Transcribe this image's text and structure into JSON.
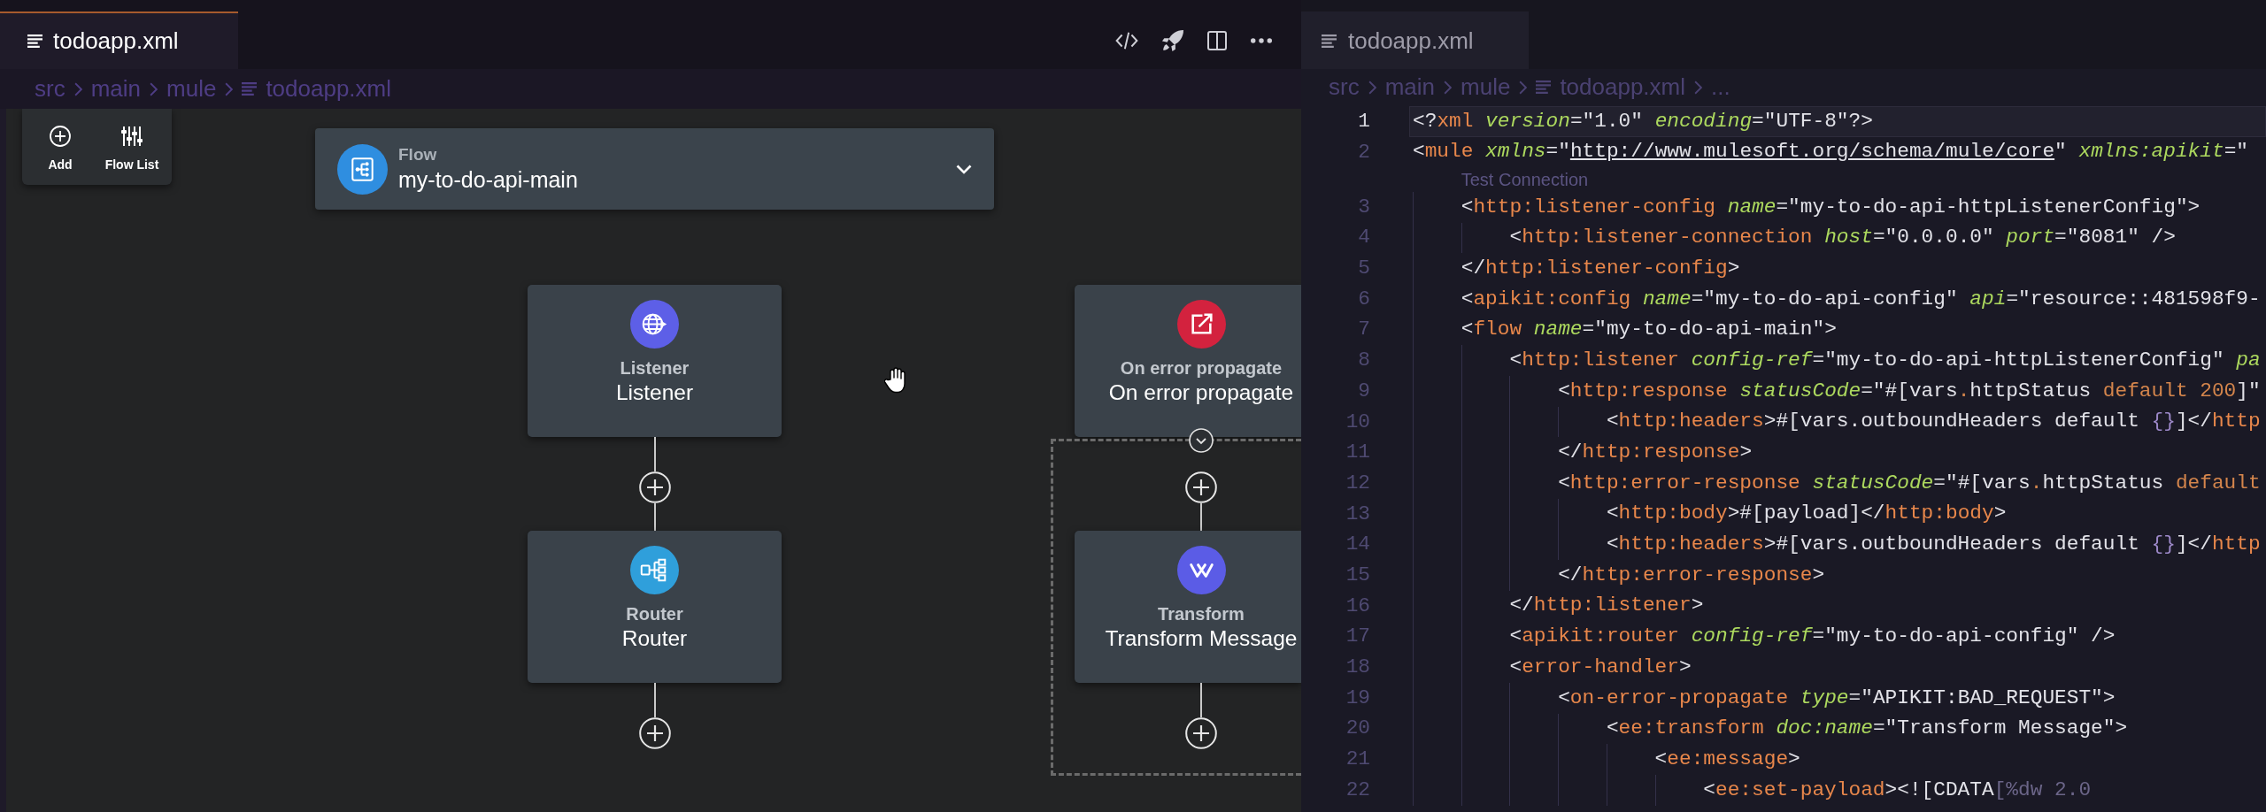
{
  "left_editor": {
    "tab": {
      "label": "todoapp.xml",
      "selected": true,
      "focused": true
    },
    "breadcrumbs": [
      {
        "label": "src",
        "kind": "folder"
      },
      {
        "label": "main",
        "kind": "folder"
      },
      {
        "label": "mule",
        "kind": "folder"
      },
      {
        "label": "todoapp.xml",
        "kind": "file"
      }
    ],
    "canvas": {
      "palette": [
        {
          "label": "Add",
          "kind": "add"
        },
        {
          "label": "Flow List",
          "kind": "flow-list"
        }
      ],
      "flow": {
        "type_label": "Flow",
        "name": "my-to-do-api-main"
      },
      "lanes": [
        {
          "kind": "flow",
          "components": [
            {
              "kind": "listener",
              "type_label": "Listener",
              "name": "Listener"
            },
            {
              "kind": "router",
              "type_label": "Router",
              "name": "Router"
            }
          ]
        },
        {
          "kind": "error-handler",
          "expanded": true,
          "handler": {
            "kind": "on-error",
            "type_label": "On error propagate",
            "name": "On error propagate"
          },
          "components": [
            {
              "kind": "transform",
              "type_label": "Transform",
              "name": "Transform Message"
            }
          ]
        }
      ]
    }
  },
  "right_editor": {
    "tab": {
      "label": "todoapp.xml",
      "selected": true,
      "focused": false
    },
    "breadcrumbs": [
      {
        "label": "src",
        "kind": "folder"
      },
      {
        "label": "main",
        "kind": "folder"
      },
      {
        "label": "mule",
        "kind": "folder"
      },
      {
        "label": "todoapp.xml",
        "kind": "file"
      },
      {
        "label": "...",
        "kind": "more"
      }
    ],
    "lines": [
      {
        "kind": "code",
        "number": "1",
        "current": true,
        "tokens": [
          {
            "kind": "plain",
            "text": "<?"
          },
          {
            "kind": "tag",
            "text": "xml "
          },
          {
            "kind": "attr",
            "text": "version"
          },
          {
            "kind": "plain",
            "text": "=\"1.0\" "
          },
          {
            "kind": "attr",
            "text": "encoding"
          },
          {
            "kind": "plain",
            "text": "=\"UTF-8\"?>"
          }
        ]
      },
      {
        "kind": "code",
        "number": "2",
        "current": false,
        "tokens": [
          {
            "kind": "plain",
            "text": "<"
          },
          {
            "kind": "tag",
            "text": "mule "
          },
          {
            "kind": "attr",
            "text": "xmlns"
          },
          {
            "kind": "plain",
            "text": "=\""
          },
          {
            "kind": "link",
            "text": "http://www.mulesoft.org/schema/mule/core"
          },
          {
            "kind": "plain",
            "text": "\" "
          },
          {
            "kind": "attr",
            "text": "xmlns:apikit"
          },
          {
            "kind": "plain",
            "text": "=\""
          }
        ]
      },
      {
        "kind": "codelens",
        "label": "Test Connection"
      },
      {
        "kind": "code",
        "number": "3",
        "current": false,
        "tokens": [
          {
            "kind": "plain",
            "text": "    <"
          },
          {
            "kind": "tag",
            "text": "http:listener-config "
          },
          {
            "kind": "attr",
            "text": "name"
          },
          {
            "kind": "plain",
            "text": "=\"my-to-do-api-httpListenerConfig\">"
          }
        ]
      },
      {
        "kind": "code",
        "number": "4",
        "current": false,
        "tokens": [
          {
            "kind": "plain",
            "text": "        <"
          },
          {
            "kind": "tag",
            "text": "http:listener-connection "
          },
          {
            "kind": "attr",
            "text": "host"
          },
          {
            "kind": "plain",
            "text": "=\"0.0.0.0\" "
          },
          {
            "kind": "attr",
            "text": "port"
          },
          {
            "kind": "plain",
            "text": "=\"8081\" />"
          }
        ]
      },
      {
        "kind": "code",
        "number": "5",
        "current": false,
        "tokens": [
          {
            "kind": "plain",
            "text": "    </"
          },
          {
            "kind": "tag",
            "text": "http:listener-config"
          },
          {
            "kind": "plain",
            "text": ">"
          }
        ]
      },
      {
        "kind": "code",
        "number": "6",
        "current": false,
        "tokens": [
          {
            "kind": "plain",
            "text": "    <"
          },
          {
            "kind": "tag",
            "text": "apikit:config "
          },
          {
            "kind": "attr",
            "text": "name"
          },
          {
            "kind": "plain",
            "text": "=\"my-to-do-api-config\" "
          },
          {
            "kind": "attr",
            "text": "api"
          },
          {
            "kind": "plain",
            "text": "=\"resource::481598f9-"
          }
        ]
      },
      {
        "kind": "code",
        "number": "7",
        "current": false,
        "tokens": [
          {
            "kind": "plain",
            "text": "    <"
          },
          {
            "kind": "tag",
            "text": "flow "
          },
          {
            "kind": "attr",
            "text": "name"
          },
          {
            "kind": "plain",
            "text": "=\"my-to-do-api-main\">"
          }
        ]
      },
      {
        "kind": "code",
        "number": "8",
        "current": false,
        "tokens": [
          {
            "kind": "plain",
            "text": "        <"
          },
          {
            "kind": "tag",
            "text": "http:listener "
          },
          {
            "kind": "attr",
            "text": "config-ref"
          },
          {
            "kind": "plain",
            "text": "=\"my-to-do-api-httpListenerConfig\" "
          },
          {
            "kind": "attr",
            "text": "pa"
          }
        ]
      },
      {
        "kind": "code",
        "number": "9",
        "current": false,
        "tokens": [
          {
            "kind": "plain",
            "text": "            <"
          },
          {
            "kind": "tag",
            "text": "http:response "
          },
          {
            "kind": "attr",
            "text": "statusCode"
          },
          {
            "kind": "plain",
            "text": "=\"#[vars"
          },
          {
            "kind": "keyword",
            "text": "."
          },
          {
            "kind": "plain",
            "text": "httpStatus "
          },
          {
            "kind": "keyword",
            "text": "default 200"
          },
          {
            "kind": "plain",
            "text": "]\""
          }
        ]
      },
      {
        "kind": "code",
        "number": "10",
        "current": false,
        "tokens": [
          {
            "kind": "plain",
            "text": "                <"
          },
          {
            "kind": "tag",
            "text": "http:headers"
          },
          {
            "kind": "plain",
            "text": ">#[vars.outboundHeaders default "
          },
          {
            "kind": "brace",
            "text": "{}"
          },
          {
            "kind": "plain",
            "text": "]</"
          },
          {
            "kind": "tag",
            "text": "http"
          }
        ]
      },
      {
        "kind": "code",
        "number": "11",
        "current": false,
        "tokens": [
          {
            "kind": "plain",
            "text": "            </"
          },
          {
            "kind": "tag",
            "text": "http:response"
          },
          {
            "kind": "plain",
            "text": ">"
          }
        ]
      },
      {
        "kind": "code",
        "number": "12",
        "current": false,
        "tokens": [
          {
            "kind": "plain",
            "text": "            <"
          },
          {
            "kind": "tag",
            "text": "http:error-response "
          },
          {
            "kind": "attr",
            "text": "statusCode"
          },
          {
            "kind": "plain",
            "text": "=\"#[vars"
          },
          {
            "kind": "keyword",
            "text": "."
          },
          {
            "kind": "plain",
            "text": "httpStatus "
          },
          {
            "kind": "keyword",
            "text": "default"
          }
        ]
      },
      {
        "kind": "code",
        "number": "13",
        "current": false,
        "tokens": [
          {
            "kind": "plain",
            "text": "                <"
          },
          {
            "kind": "tag",
            "text": "http:body"
          },
          {
            "kind": "plain",
            "text": ">#[payload]</"
          },
          {
            "kind": "tag",
            "text": "http:body"
          },
          {
            "kind": "plain",
            "text": ">"
          }
        ]
      },
      {
        "kind": "code",
        "number": "14",
        "current": false,
        "tokens": [
          {
            "kind": "plain",
            "text": "                <"
          },
          {
            "kind": "tag",
            "text": "http:headers"
          },
          {
            "kind": "plain",
            "text": ">#[vars.outboundHeaders default "
          },
          {
            "kind": "brace",
            "text": "{}"
          },
          {
            "kind": "plain",
            "text": "]</"
          },
          {
            "kind": "tag",
            "text": "http"
          }
        ]
      },
      {
        "kind": "code",
        "number": "15",
        "current": false,
        "tokens": [
          {
            "kind": "plain",
            "text": "            </"
          },
          {
            "kind": "tag",
            "text": "http:error-response"
          },
          {
            "kind": "plain",
            "text": ">"
          }
        ]
      },
      {
        "kind": "code",
        "number": "16",
        "current": false,
        "tokens": [
          {
            "kind": "plain",
            "text": "        </"
          },
          {
            "kind": "tag",
            "text": "http:listener"
          },
          {
            "kind": "plain",
            "text": ">"
          }
        ]
      },
      {
        "kind": "code",
        "number": "17",
        "current": false,
        "tokens": [
          {
            "kind": "plain",
            "text": "        <"
          },
          {
            "kind": "tag",
            "text": "apikit:router "
          },
          {
            "kind": "attr",
            "text": "config-ref"
          },
          {
            "kind": "plain",
            "text": "=\"my-to-do-api-config\" />"
          }
        ]
      },
      {
        "kind": "code",
        "number": "18",
        "current": false,
        "tokens": [
          {
            "kind": "plain",
            "text": "        <"
          },
          {
            "kind": "tag",
            "text": "error-handler"
          },
          {
            "kind": "plain",
            "text": ">"
          }
        ]
      },
      {
        "kind": "code",
        "number": "19",
        "current": false,
        "tokens": [
          {
            "kind": "plain",
            "text": "            <"
          },
          {
            "kind": "tag",
            "text": "on-error-propagate "
          },
          {
            "kind": "attr",
            "text": "type"
          },
          {
            "kind": "plain",
            "text": "=\"APIKIT:BAD_REQUEST\">"
          }
        ]
      },
      {
        "kind": "code",
        "number": "20",
        "current": false,
        "tokens": [
          {
            "kind": "plain",
            "text": "                <"
          },
          {
            "kind": "tag",
            "text": "ee:transform "
          },
          {
            "kind": "attr",
            "text": "doc:name"
          },
          {
            "kind": "plain",
            "text": "=\"Transform Message\">"
          }
        ]
      },
      {
        "kind": "code",
        "number": "21",
        "current": false,
        "tokens": [
          {
            "kind": "plain",
            "text": "                    <"
          },
          {
            "kind": "tag",
            "text": "ee:message"
          },
          {
            "kind": "plain",
            "text": ">"
          }
        ]
      },
      {
        "kind": "code",
        "number": "22",
        "current": false,
        "tokens": [
          {
            "kind": "plain",
            "text": "                        <"
          },
          {
            "kind": "tag",
            "text": "ee:set-payload"
          },
          {
            "kind": "plain",
            "text": "><![CDATA"
          },
          {
            "kind": "dim",
            "text": "[%dw 2.0"
          }
        ]
      }
    ]
  }
}
